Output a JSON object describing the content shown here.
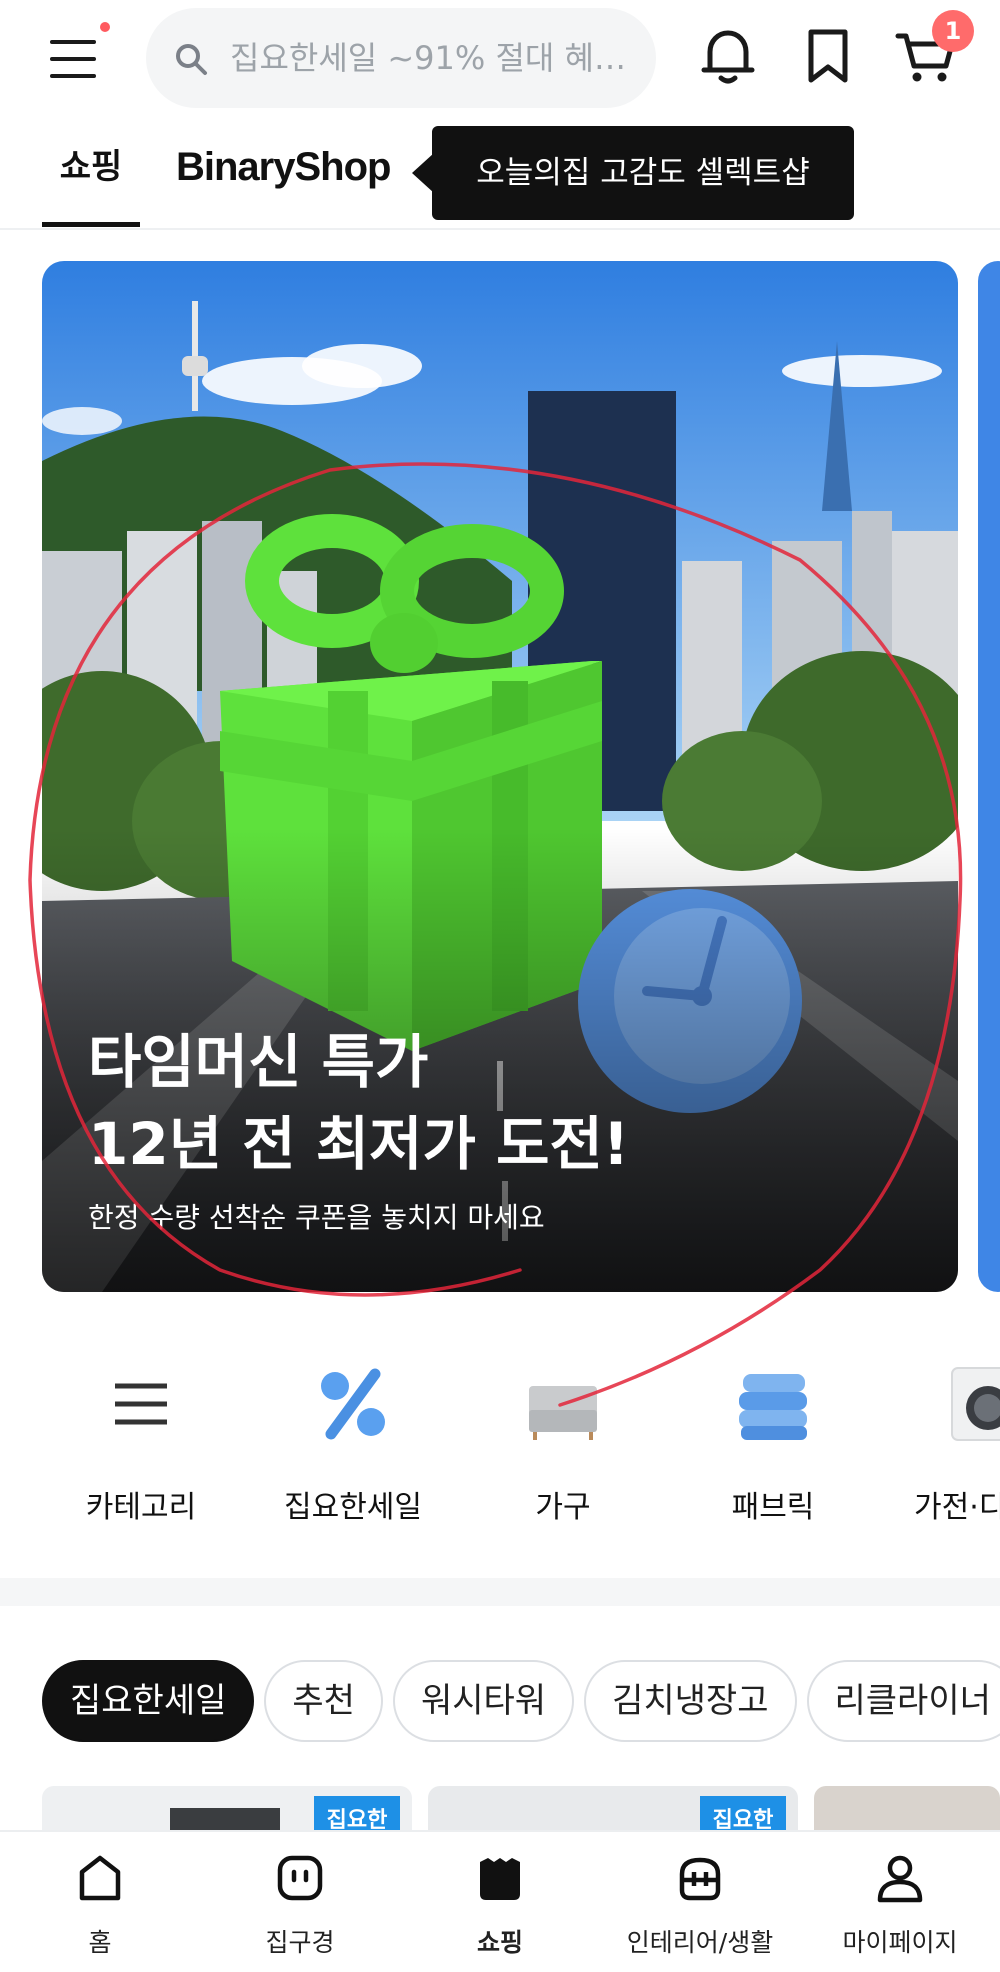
{
  "header": {
    "search": {
      "placeholder": "집요한세일 ~91% 절대 혜…",
      "icon": "search-icon"
    },
    "cart_badge": "1",
    "icons": [
      "menu-icon",
      "bell-icon",
      "bookmark-icon",
      "cart-icon"
    ]
  },
  "tabs": {
    "shopping": "쇼핑",
    "binary_shop": "BinaryShop",
    "tooltip": "오늘의집 고감도 셀렉트샵"
  },
  "banner": {
    "title": "타임머신 특가\n12년 전 최저가 도전!",
    "subtitle": "한정 수량 선착순 쿠폰을 놓치지 마세요"
  },
  "categories": [
    {
      "label": "카테고리",
      "icon": "list-icon"
    },
    {
      "label": "집요한세일",
      "icon": "percent-icon"
    },
    {
      "label": "가구",
      "icon": "sofa-icon"
    },
    {
      "label": "패브릭",
      "icon": "fabric-icon"
    },
    {
      "label": "가전·디",
      "icon": "washer-icon"
    }
  ],
  "chips": [
    "집요한세일",
    "추천",
    "워시타워",
    "김치냉장고",
    "리클라이너"
  ],
  "product_badge": "집요한",
  "bottom_nav": [
    {
      "label": "홈",
      "icon": "home-icon"
    },
    {
      "label": "집구경",
      "icon": "house-face-icon"
    },
    {
      "label": "쇼핑",
      "icon": "shopping-icon"
    },
    {
      "label": "인테리어/생활",
      "icon": "bag-icon"
    },
    {
      "label": "마이페이지",
      "icon": "user-icon"
    }
  ],
  "colors": {
    "accent_red": "#ff6b6b",
    "badge_blue": "#1e90e6",
    "gift_green": "#5ee13c"
  }
}
